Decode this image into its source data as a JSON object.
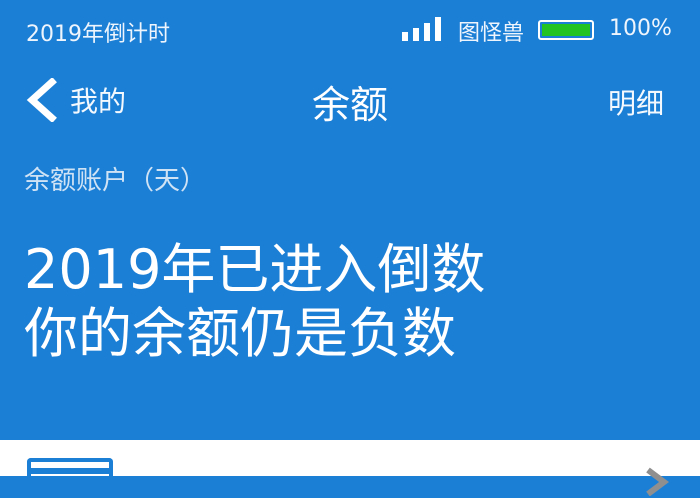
{
  "status_bar": {
    "left_text": "2019年倒计时",
    "carrier": "图怪兽",
    "battery_percent_text": "100%",
    "battery_level": 1.0,
    "signal_icon": "signal-bars-icon",
    "battery_icon": "battery-icon"
  },
  "nav": {
    "back_label": "我的",
    "back_icon": "chevron-left-icon",
    "title": "余额",
    "detail_label": "明细"
  },
  "account": {
    "label": "余额账户（天）"
  },
  "headline": {
    "line1": "2019年已进入倒数",
    "line2": "你的余额仍是负数"
  },
  "panel": {
    "row_icon": "card-icon",
    "row_label": "",
    "chevron_icon": "chevron-right-icon"
  },
  "colors": {
    "primary": "#1c7fd6",
    "battery_fill": "#22c322",
    "panel_bg": "#ffffff"
  }
}
